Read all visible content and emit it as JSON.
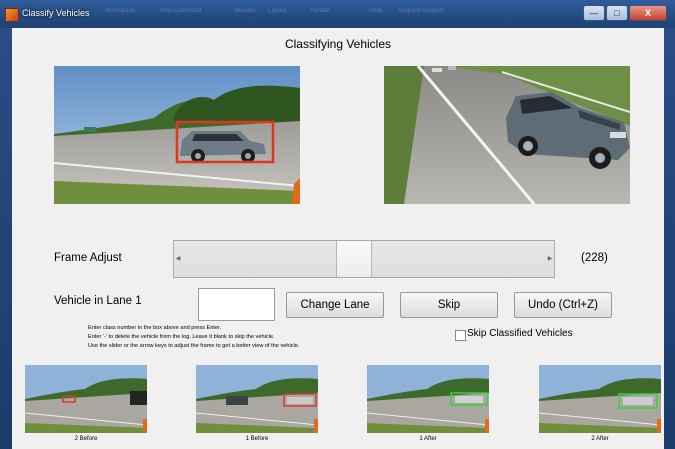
{
  "window": {
    "title": "Classify Vehicles",
    "minimize_glyph": "—",
    "maximize_glyph": "□",
    "close_glyph": "X",
    "background_menu": [
      "Workspace",
      "New Command",
      "Variable",
      "Layout",
      "Parallel",
      "Help",
      "Request Support"
    ]
  },
  "figure": {
    "title": "Classifying Vehicles"
  },
  "frame_adjust": {
    "label": "Frame Adjust",
    "value_text": "(228)",
    "slider_position": 0.47
  },
  "vehicle": {
    "label": "Vehicle in Lane 1",
    "input_value": ""
  },
  "buttons": {
    "change_lane": "Change Lane",
    "skip": "Skip",
    "undo": "Undo (Ctrl+Z)"
  },
  "instructions": [
    "Enter class number in the box above and press Enter.",
    "Enter '-' to delete the vehicle from the log. Leave it blank to skip the vehicle.",
    "Use the slider or the arrow keys to adjust the frame to get a better view of the vehicle."
  ],
  "skip_classified": {
    "label": "Skip Classified Vehicles",
    "checked": false
  },
  "thumbnails": [
    {
      "caption": "2 Before",
      "box_color": "#d8392a"
    },
    {
      "caption": "1 Before",
      "box_color": "#d8392a"
    },
    {
      "caption": "1 After",
      "box_color": "#3ecf3e"
    },
    {
      "caption": "2 After",
      "box_color": "#3ecf3e"
    }
  ],
  "colors": {
    "highlight_box": "#e0361e",
    "window_frame": "#1d3a66"
  }
}
